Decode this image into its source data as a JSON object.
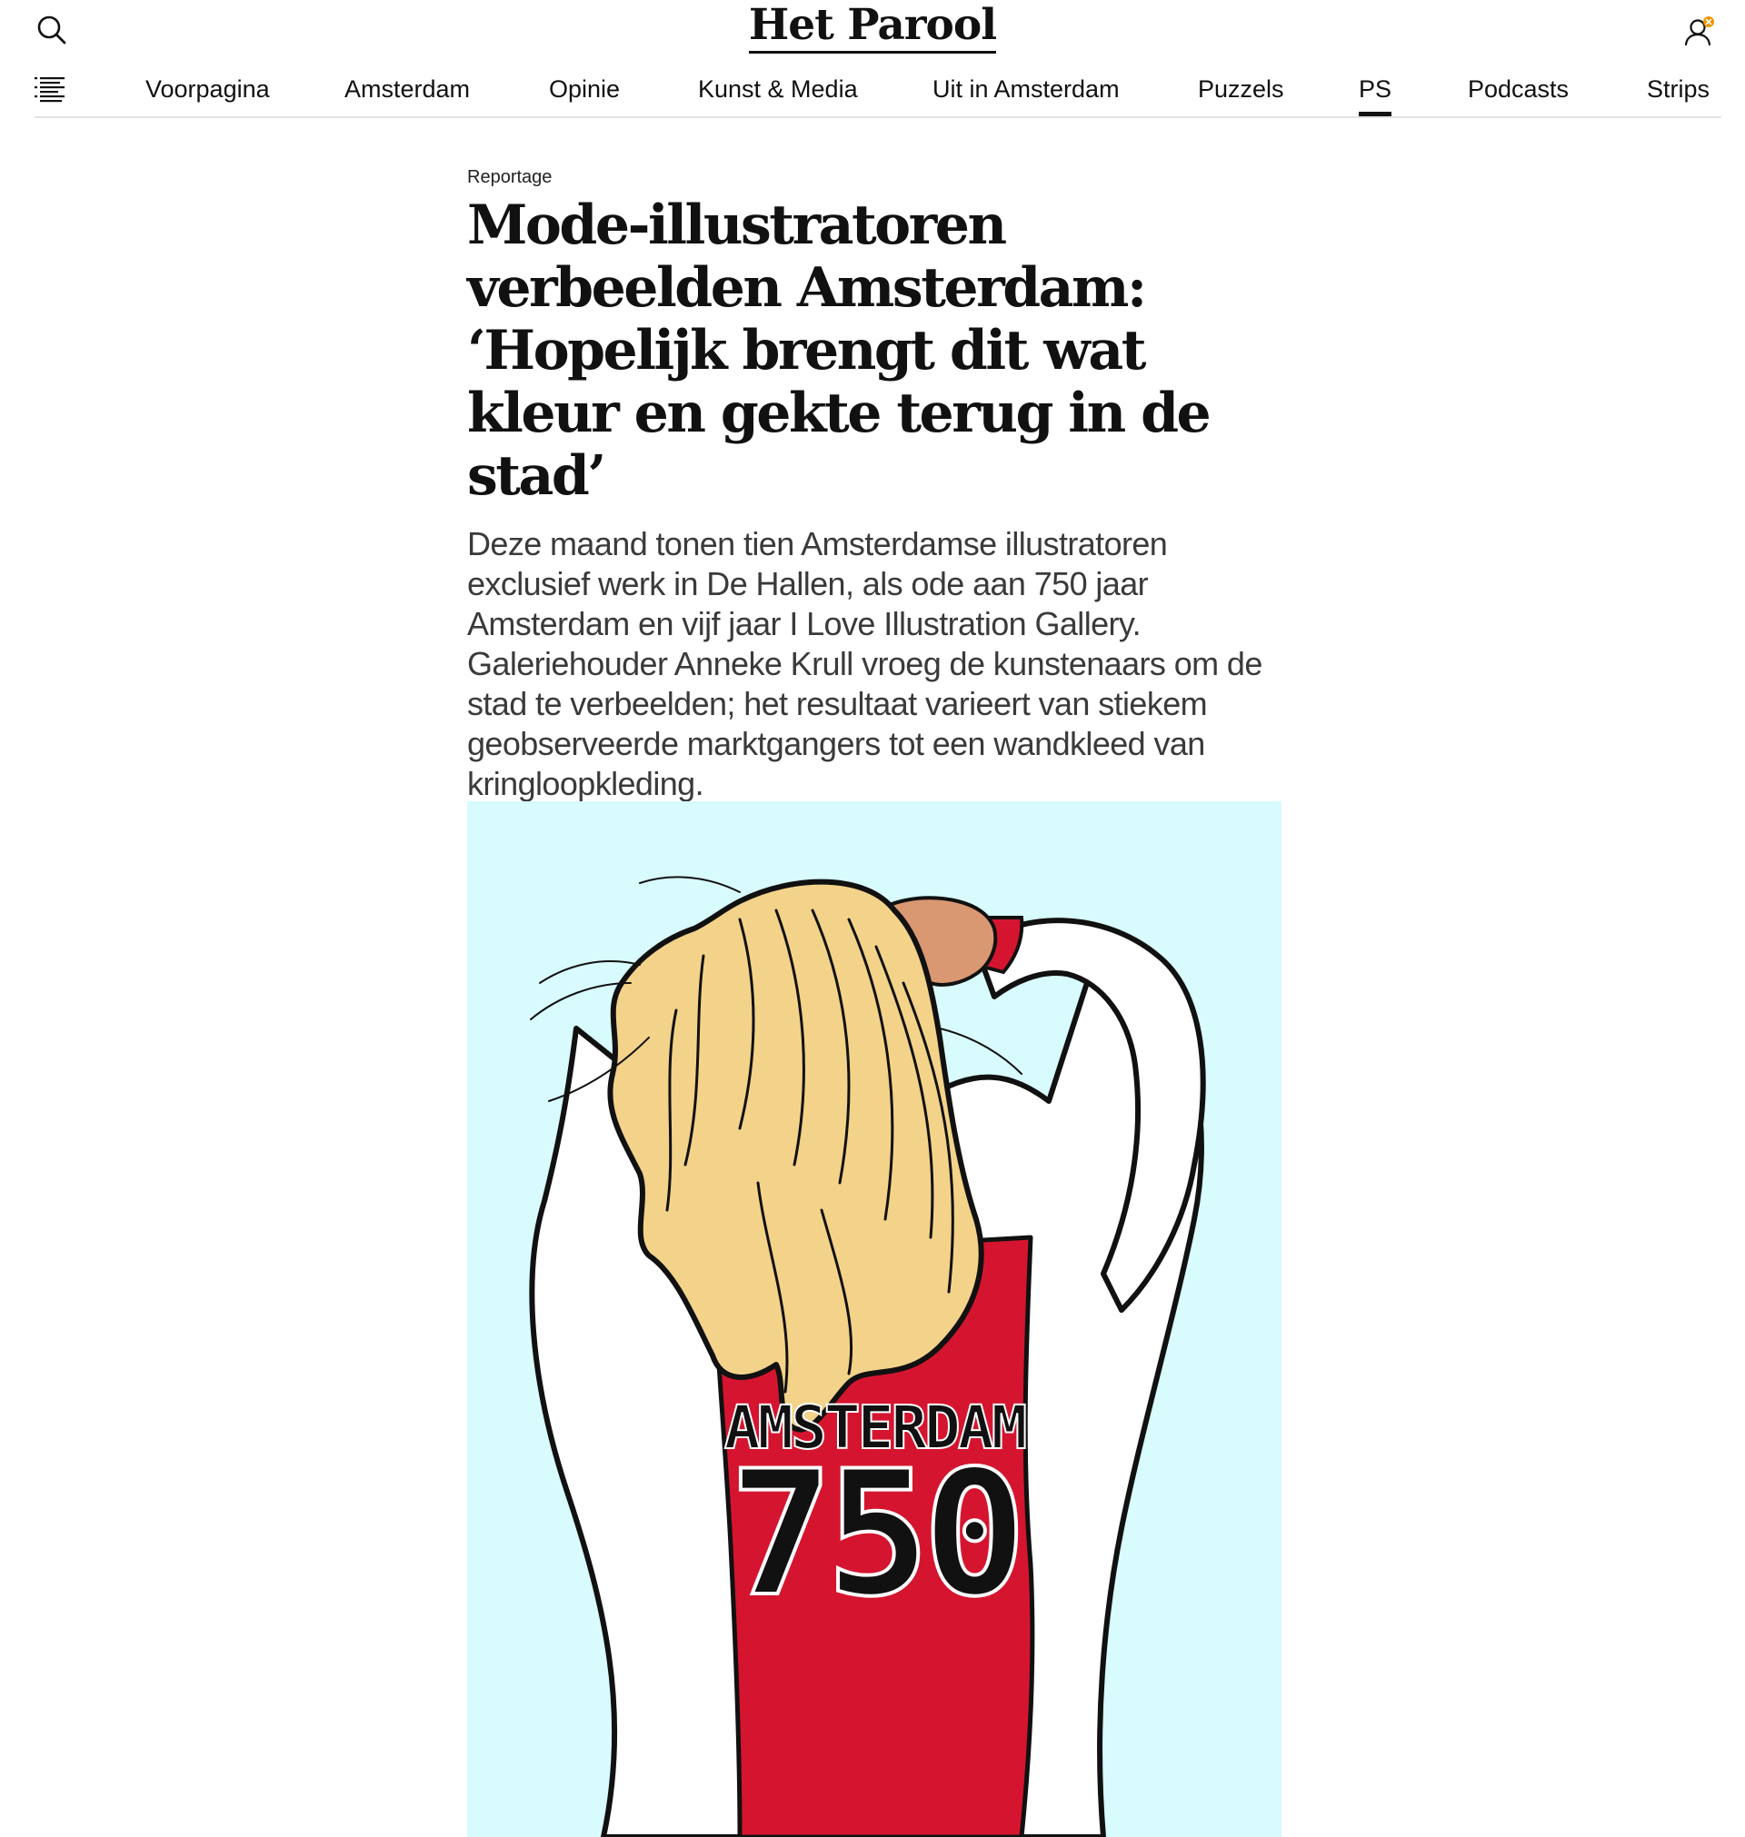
{
  "header": {
    "logo": "Het Parool",
    "search_icon": "search-icon",
    "account_icon": "account-icon",
    "menu_icon": "menu-list-icon",
    "notification_color": "#f39200"
  },
  "nav": {
    "items": [
      {
        "label": "Voorpagina"
      },
      {
        "label": "Amsterdam"
      },
      {
        "label": "Opinie"
      },
      {
        "label": "Kunst & Media"
      },
      {
        "label": "Uit in Amsterdam"
      },
      {
        "label": "Puzzels"
      },
      {
        "label": "PS",
        "active": true
      },
      {
        "label": "Podcasts"
      },
      {
        "label": "Strips"
      }
    ]
  },
  "article": {
    "kicker": "Reportage",
    "headline": "Mode-illustratoren verbeelden Amsterdam: ‘Hopelijk brengt dit wat kleur en gekte terug in de stad’",
    "intro": "Deze maand tonen tien Amsterdamse illustratoren exclusief werk in De Hallen, als ode aan 750 jaar Amsterdam en vijf jaar I Love Illustration Gallery. Galeriehouder Anneke Krull vroeg de kunstenaars om de stad te verbeelden; het resultaat varieert van stiekem geobserveerde marktgangers tot een wandkleed van kringloopkleding."
  },
  "illustration": {
    "shirt_text": "AMSTERDAM",
    "shirt_number": "750",
    "background_color": "#d8fbfd",
    "hair_color": "#f3d38a",
    "shirt_red": "#d5152f",
    "skin_color": "#d99872"
  }
}
